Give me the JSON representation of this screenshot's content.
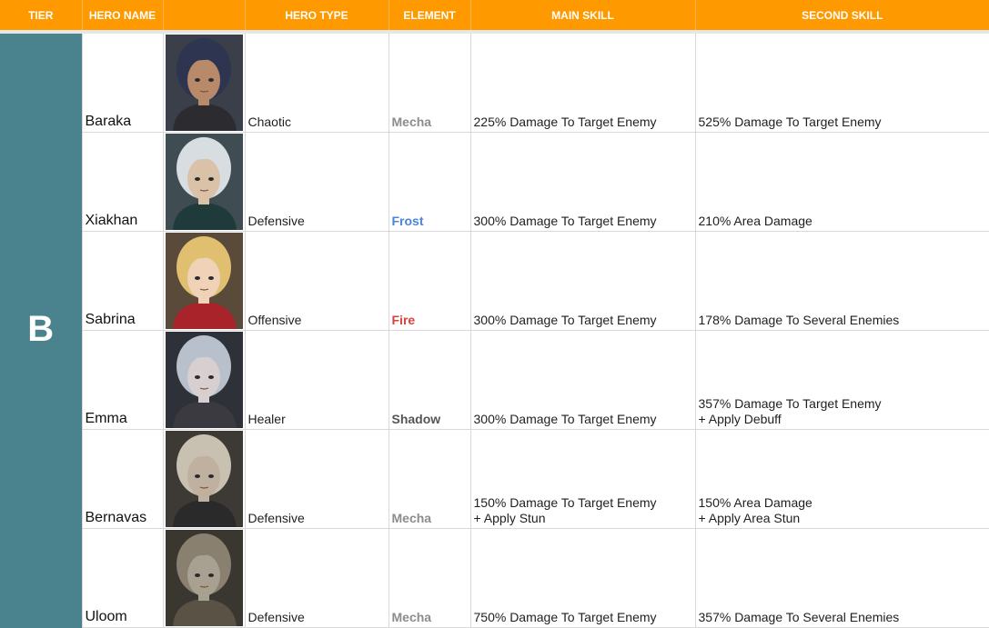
{
  "header": {
    "tier": "TIER",
    "hero_name": "HERO NAME",
    "portrait": "",
    "hero_type": "HERO TYPE",
    "element": "ELEMENT",
    "main_skill": "MAIN SKILL",
    "second_skill": "SECOND SKILL"
  },
  "tier": "B",
  "element_colors": {
    "Mecha": "#8c8c8c",
    "Frost": "#4a86d6",
    "Fire": "#d9423a",
    "Shadow": "#555555"
  },
  "rows": [
    {
      "name": "Baraka",
      "type": "Chaotic",
      "element": "Mecha",
      "main_skill": "225% Damage To Target Enemy",
      "second_skill": [
        "525% Damage To Target Enemy"
      ]
    },
    {
      "name": "Xiakhan",
      "type": "Defensive",
      "element": "Frost",
      "main_skill": "300% Damage To Target Enemy",
      "second_skill": [
        "210% Area Damage"
      ]
    },
    {
      "name": "Sabrina",
      "type": "Offensive",
      "element": "Fire",
      "main_skill": "300% Damage To Target Enemy",
      "second_skill": [
        "178% Damage To Several Enemies"
      ]
    },
    {
      "name": "Emma",
      "type": "Healer",
      "element": "Shadow",
      "main_skill": "300% Damage To Target Enemy",
      "second_skill": [
        "357% Damage To Target Enemy",
        "+ Apply Debuff"
      ]
    },
    {
      "name": "Bernavas",
      "type": "Defensive",
      "element": "Mecha",
      "main_skill": [
        "150% Damage To Target Enemy",
        "+ Apply Stun"
      ],
      "second_skill": [
        "150% Area Damage",
        "+ Apply Area Stun"
      ]
    },
    {
      "name": "Uloom",
      "type": "Defensive",
      "element": "Mecha",
      "main_skill": "750% Damage To Target Enemy",
      "second_skill": [
        "357% Damage To Several Enemies"
      ]
    }
  ]
}
